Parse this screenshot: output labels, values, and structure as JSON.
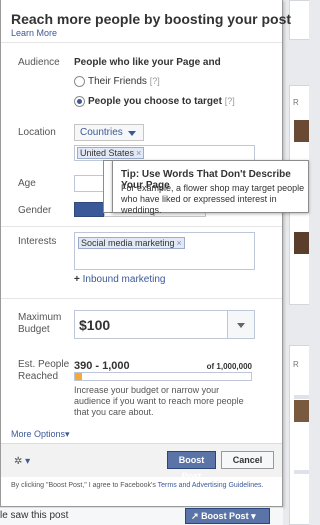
{
  "dialog": {
    "title": "Reach more people by boosting your post",
    "learn_more": "Learn More"
  },
  "audience": {
    "label": "Audience",
    "header": "People who like your Page and",
    "options": [
      {
        "label": "Their Friends",
        "hint": "[?]",
        "selected": false
      },
      {
        "label": "People you choose to target",
        "hint": "[?]",
        "selected": true
      }
    ]
  },
  "location": {
    "label": "Location",
    "select_value": "Countries",
    "token": "United States",
    "token_remove": "×"
  },
  "age": {
    "label": "Age"
  },
  "gender": {
    "label": "Gender"
  },
  "tooltip": {
    "title": "Tip: Use Words That Don't Describe Your Page",
    "body": "For example, a flower shop may target people who have liked or expressed interest in weddings."
  },
  "interests": {
    "label": "Interests",
    "token": "Social media marketing",
    "token_remove": "×",
    "suggestion_prefix": "+",
    "suggestion": "Inbound marketing"
  },
  "budget": {
    "label": "Maximum Budget",
    "value": "$100"
  },
  "reach": {
    "label": "Est. People Reached",
    "range": "390 - 1,000",
    "total": "of 1,000,000",
    "fill_fraction": 0.04,
    "note": "Increase your budget or narrow your audience if you want to reach more people that you care about."
  },
  "more_options": "More Options",
  "more_options_arrow": "▾",
  "footer": {
    "settings_icon": "✲",
    "settings_arrow": "▾",
    "boost_label": "Boost Post",
    "cancel_label": "Cancel",
    "terms_prefix": "By clicking \"Boost Post,\" I agree to Facebook's ",
    "terms_link": "Terms and Advertising Guidelines",
    "terms_suffix": "."
  },
  "background": {
    "saw_text": "le saw this post",
    "boost_button": "Boost Post",
    "boost_icon": "↗",
    "boost_arrow": "▾",
    "right_labels": [
      "R",
      "R"
    ]
  },
  "colors": {
    "link": "#3b5998",
    "primary_button": "#5b74a8",
    "reach_fill": "#f7a835"
  }
}
